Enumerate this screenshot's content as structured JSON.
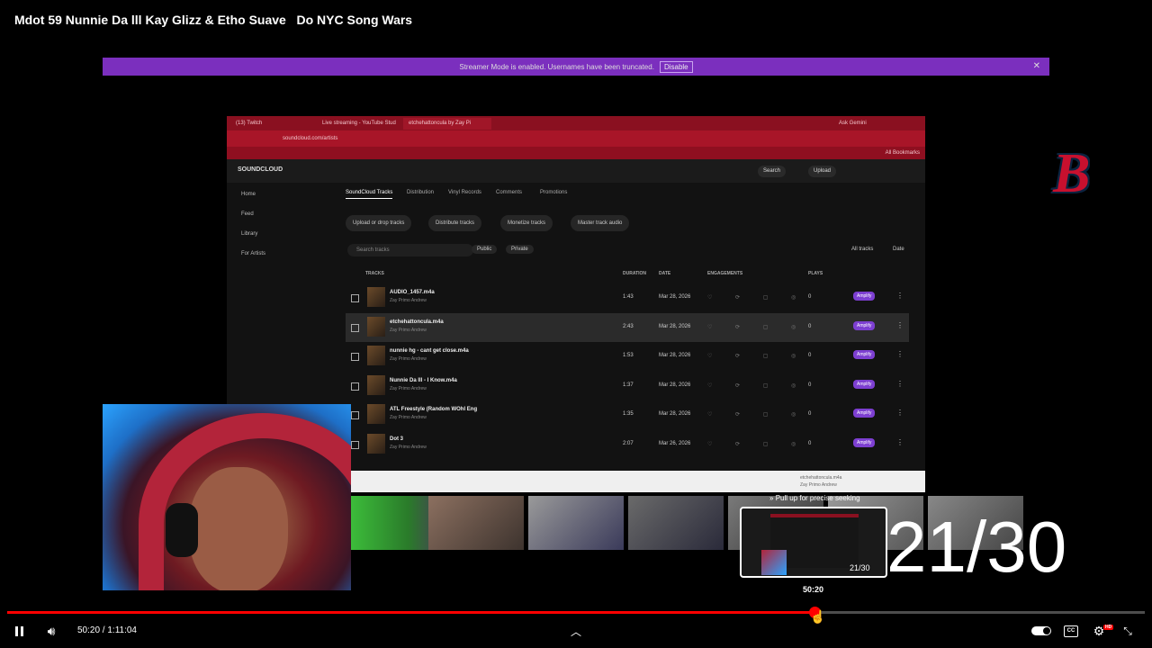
{
  "video": {
    "title": "Mdot 59 Nunnie Da lll Kay Glizz & Etho Suave   Do NYC Song Wars"
  },
  "streamer_bar": {
    "message": "Streamer Mode is enabled. Usernames have been truncated.",
    "button_label": "Disable",
    "close_glyph": "✕"
  },
  "browser": {
    "tabs": [
      "(13) Twitch",
      "Live streaming - YouTube Stud",
      "etchehattoncula by Zay Pi"
    ],
    "address": "soundcloud.com/artists",
    "bookmarks_label": "All Bookmarks",
    "profile_label": "Ask Gemini"
  },
  "soundcloud": {
    "logo": "SOUNDCLOUD",
    "search_label": "Search",
    "upload_label": "Upload",
    "sidebar": [
      "Home",
      "Feed",
      "Library",
      "For Artists"
    ],
    "tabs": [
      "SoundCloud Tracks",
      "Distribution",
      "Vinyl Records",
      "Comments",
      "Promotions"
    ],
    "actions": [
      "Upload or drop tracks",
      "Distribute tracks",
      "Monetize tracks",
      "Master track audio"
    ],
    "search_placeholder": "Search tracks",
    "filters": [
      "Public",
      "Private"
    ],
    "tracks_count": "All tracks",
    "sort_label": "Date",
    "columns": [
      "TRACKS",
      "DURATION",
      "DATE",
      "ENGAGEMENTS",
      "PLAYS"
    ],
    "rows": [
      {
        "title": "AUDIO_1457.m4a",
        "artist": "Zay Primo Andrew",
        "duration": "1:43",
        "date": "Mar 28, 2026",
        "plays": "0",
        "amplify": "Amplify"
      },
      {
        "title": "etchehattoncula.m4a",
        "artist": "Zay Primo Andrew",
        "duration": "2:43",
        "date": "Mar 28, 2026",
        "plays": "0",
        "amplify": "Amplify"
      },
      {
        "title": "nunnie hg - cant get close.m4a",
        "artist": "Zay Primo Andrew",
        "duration": "1:53",
        "date": "Mar 28, 2026",
        "plays": "0",
        "amplify": "Amplify"
      },
      {
        "title": "Nunnie Da lll - I Know.m4a",
        "artist": "Zay Primo Andrew",
        "duration": "1:37",
        "date": "Mar 28, 2026",
        "plays": "0",
        "amplify": "Amplify"
      },
      {
        "title": "ATL Freestyle (Random WOhl Eng",
        "artist": "Zay Primo Andrew",
        "duration": "1:35",
        "date": "Mar 28, 2026",
        "plays": "0",
        "amplify": "Amplify"
      },
      {
        "title": "Dot 3",
        "artist": "Zay Primo Andrew",
        "duration": "2:07",
        "date": "Mar 26, 2026",
        "plays": "0",
        "amplify": "Amplify"
      }
    ],
    "player_track": "etchehattoncula.m4a",
    "player_artist": "Zay Primo Andrew"
  },
  "overlay": {
    "counter": "21/30",
    "logo_letter": "B"
  },
  "seek_preview": {
    "hint": "Pull up for precise seeking",
    "counter": "21/30",
    "time": "50:20"
  },
  "player": {
    "progress_fraction": 0.7096,
    "current_time": "50:20",
    "duration": "1:11:04",
    "time_display": "50:20 / 1:11:04",
    "hd_badge": "HD",
    "accent_color": "#ff0000"
  },
  "icons": {
    "pause": "pause-icon",
    "volume": "volume-icon",
    "chevron_up": "chevron-up-icon",
    "autoplay": "autoplay-toggle",
    "cc": "cc-icon",
    "settings": "settings-icon",
    "exit_fullscreen": "exit-fullscreen-icon"
  }
}
